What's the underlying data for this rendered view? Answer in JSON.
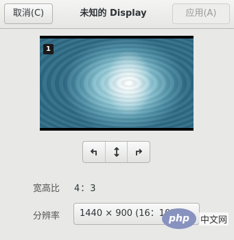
{
  "header": {
    "cancel_label": "取消(C)",
    "title": "未知的 Display",
    "apply_label": "应用(A)"
  },
  "preview": {
    "monitor_number": "1"
  },
  "rotation": {
    "buttons": [
      "rotate-left-icon",
      "flip-vertical-icon",
      "rotate-right-icon"
    ]
  },
  "settings": {
    "aspect_ratio_label": "宽高比",
    "aspect_ratio_value": "4：3",
    "resolution_label": "分辨率",
    "resolution_value": "1440 × 900 (16：10)"
  },
  "watermark": {
    "logo_text": "php",
    "site_text": "中文网"
  }
}
